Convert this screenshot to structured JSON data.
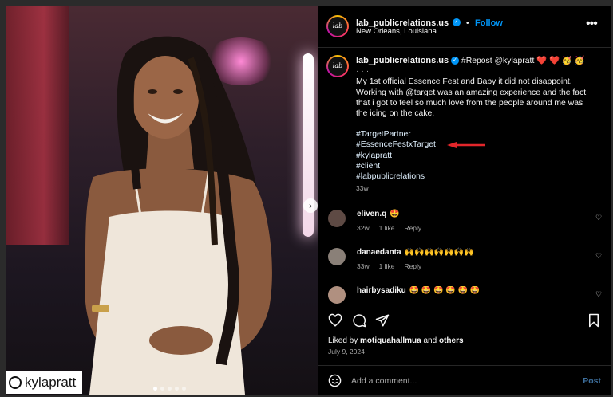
{
  "photo": {
    "tagged_user": "kylapratt",
    "carousel_dots": 5,
    "active_dot": 0
  },
  "header": {
    "username": "lab_publicrelations.us",
    "separator": "•",
    "follow_label": "Follow",
    "location": "New Orleans, Louisiana",
    "avatar_text": "lab",
    "more_icon": "more-horizontal-icon"
  },
  "caption": {
    "username": "lab_publicrelations.us",
    "repost": "#Repost @kylapratt",
    "emoji_tail": "❤️ ❤️ 🥳 🥳",
    "dots": "·  ·  ·",
    "lines": [
      "My 1st official Essence Fest and Baby it did not disappoint.",
      "Working with @target was an amazing experience and the fact",
      "that i got to feel so much love from the people around me was",
      "the icing on the cake."
    ],
    "hashtags": [
      "#TargetPartner",
      "#EssenceFestxTarget",
      "#kylapratt",
      "#client",
      "#labpublicrelations"
    ],
    "age": "33w"
  },
  "comments": [
    {
      "user": "eliven.q",
      "text": "🤩",
      "age": "32w",
      "likes": "1 like",
      "reply": "Reply"
    },
    {
      "user": "danaedanta",
      "text": "🙌🙌🙌🙌🙌🙌🙌",
      "age": "33w",
      "likes": "1 like",
      "reply": "Reply"
    },
    {
      "user": "hairbysadiku",
      "text": "🤩 🤩 🤩 🤩 🤩 🤩",
      "age": "",
      "likes": "",
      "reply": ""
    }
  ],
  "likes": {
    "prefix": "Liked by",
    "user": "motiquahallmua",
    "and": "and",
    "others": "others"
  },
  "post_date": "July 9, 2024",
  "add_comment": {
    "placeholder": "Add a comment...",
    "post_label": "Post"
  },
  "colors": {
    "accent": "#0095f6",
    "annotation_arrow": "#e3262b",
    "panel_bg": "#000000"
  }
}
